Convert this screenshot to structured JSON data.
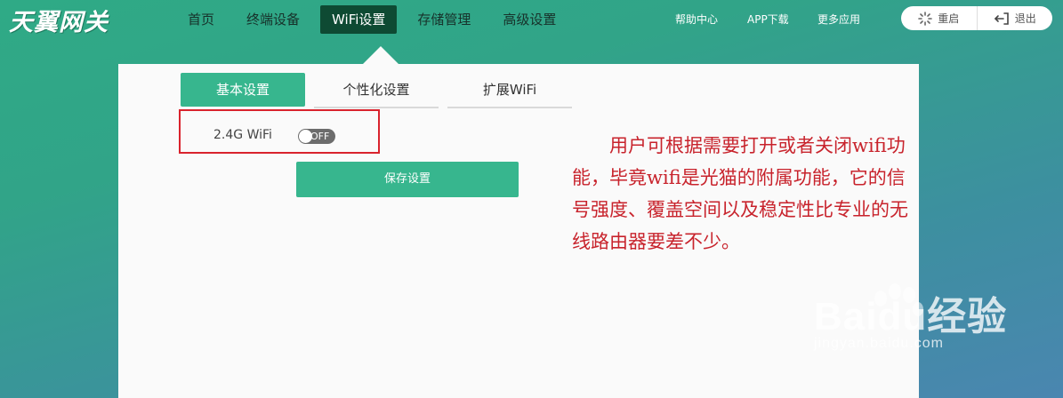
{
  "logo": {
    "text": "天翼网关"
  },
  "nav": {
    "items": [
      {
        "label": "首页"
      },
      {
        "label": "终端设备"
      },
      {
        "label": "WiFi设置"
      },
      {
        "label": "存储管理"
      },
      {
        "label": "高级设置"
      }
    ],
    "active_index": 2
  },
  "header_links": {
    "help": "帮助中心",
    "app": "APP下载",
    "more": "更多应用"
  },
  "actions": {
    "reboot": "重启",
    "logout": "退出"
  },
  "tabs": [
    {
      "label": "基本设置"
    },
    {
      "label": "个性化设置"
    },
    {
      "label": "扩展WiFi"
    }
  ],
  "wifi": {
    "label": "2.4G WiFi",
    "toggle_state": "OFF"
  },
  "save_button": {
    "label": "保存设置"
  },
  "annotation": {
    "text": "用户可根据需要打开或者关闭wifi功能，毕竟wifi是光猫的附属功能，它的信号强度、覆盖空间以及稳定性比专业的无线路由器要差不少。"
  },
  "watermark": {
    "brand": "Baidu经验",
    "url": "jingyan.baidu.com"
  },
  "colors": {
    "primary": "#37b68e",
    "nav_active": "#0e4a33",
    "highlight_border": "#d9232d",
    "annotation_text": "#c8232c"
  }
}
